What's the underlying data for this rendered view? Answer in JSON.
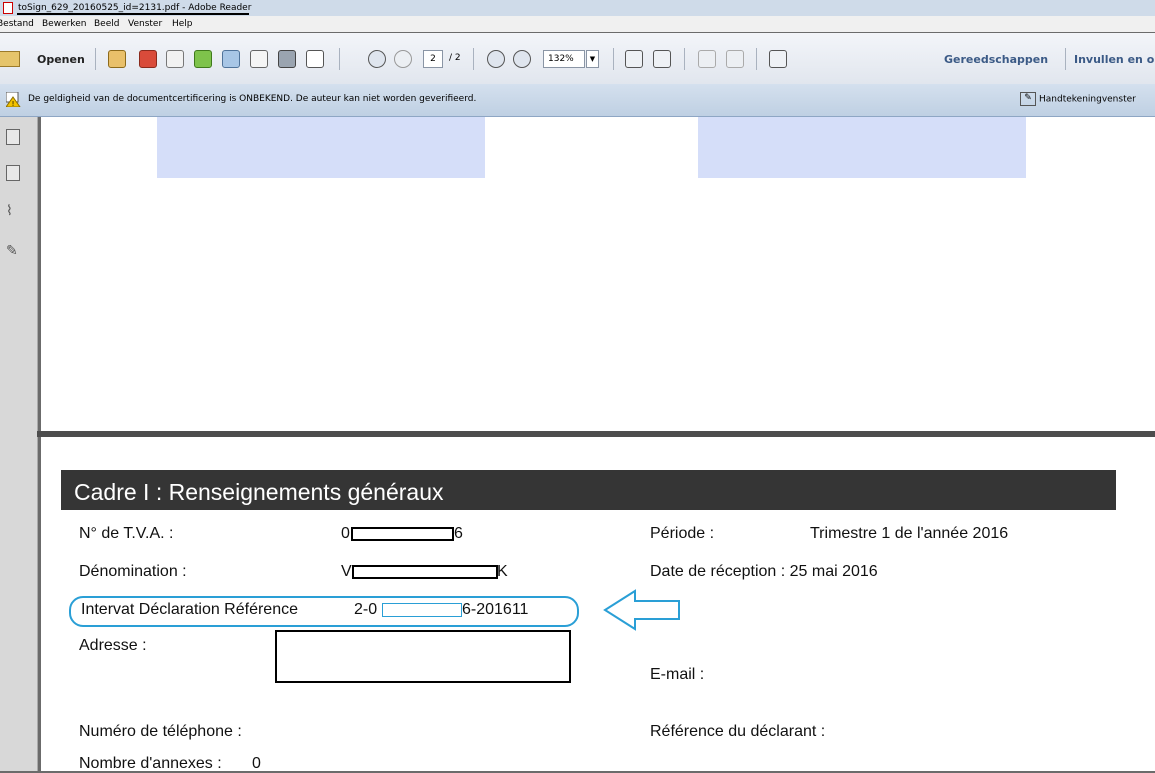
{
  "window": {
    "title": "toSign_629_20160525_id=2131.pdf - Adobe Reader"
  },
  "menubar": {
    "items": [
      "Bestand",
      "Bewerken",
      "Beeld",
      "Venster",
      "Help"
    ]
  },
  "toolbar": {
    "open_label": "Openen",
    "current_page": "2",
    "page_total": "/ 2",
    "zoom": "132%",
    "tools_label": "Gereedschappen",
    "fill_sign_label": "Invullen en o"
  },
  "notice": {
    "text": "De geldigheid van de documentcertificering is ONBEKEND. De auteur kan niet worden geverifieerd.",
    "signature_button": "Handtekeningvenster"
  },
  "document": {
    "section_title": "Cadre I : Renseignements généraux",
    "vat_label": "N° de T.V.A. :",
    "vat_prefix": "0",
    "vat_suffix": "6",
    "name_label": "Dénomination :",
    "name_prefix": "V",
    "name_suffix": "K",
    "ref_label": "Intervat Déclaration Référence",
    "ref_prefix": "2-0",
    "ref_suffix": "6-201611",
    "address_label": "Adresse :",
    "phone_label": "Numéro de téléphone :",
    "annexes_label": "Nombre d'annexes :",
    "annexes_value": "0",
    "period_label": "Période :",
    "period_value": "Trimestre 1 de l'année 2016",
    "reception_label": "Date de réception : 25 mai 2016",
    "email_label": "E-mail :",
    "declarant_ref_label": "Référence du déclarant :"
  },
  "colors": {
    "highlight_blue": "#2a9fd6",
    "header_dark": "#353535",
    "field_shade": "#d5def9"
  }
}
